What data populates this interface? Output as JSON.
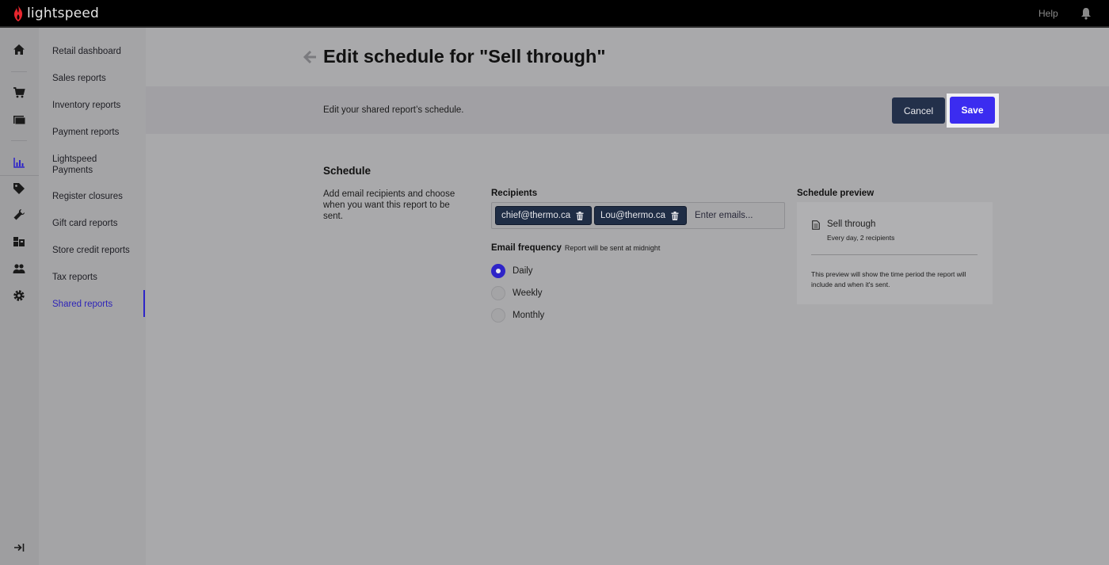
{
  "app": {
    "brand": "lightspeed",
    "help_label": "Help"
  },
  "colors": {
    "accent": "#3b2cf0",
    "dark_button": "#23304a",
    "active_nav": "#2e24b8"
  },
  "rail": {
    "icons": [
      "home-icon",
      "cart-icon",
      "register-icon",
      "reports-icon",
      "tag-icon",
      "wrench-icon",
      "inventory-icon",
      "customers-icon",
      "settings-icon"
    ],
    "collapse_icon": "collapse-icon"
  },
  "subnav": {
    "items": [
      {
        "label": "Retail dashboard"
      },
      {
        "label": "Sales reports"
      },
      {
        "label": "Inventory reports"
      },
      {
        "label": "Payment reports"
      },
      {
        "label": "Lightspeed Payments"
      },
      {
        "label": "Register closures"
      },
      {
        "label": "Gift card reports"
      },
      {
        "label": "Store credit reports"
      },
      {
        "label": "Tax reports"
      },
      {
        "label": "Shared reports",
        "active": true
      }
    ]
  },
  "header": {
    "title": "Edit schedule for \"Sell through\""
  },
  "band": {
    "text": "Edit your shared report’s schedule.",
    "cancel_label": "Cancel",
    "save_label": "Save"
  },
  "schedule": {
    "title": "Schedule",
    "description": "Add email recipients and choose when you want this report to be sent.",
    "recipients_label": "Recipients",
    "recipients": [
      "chief@thermo.ca",
      "Lou@thermo.ca"
    ],
    "email_placeholder": "Enter emails...",
    "frequency_label": "Email frequency",
    "frequency_note": "Report will be sent at midnight",
    "frequency_options": [
      {
        "label": "Daily",
        "checked": true
      },
      {
        "label": "Weekly",
        "checked": false
      },
      {
        "label": "Monthly",
        "checked": false
      }
    ]
  },
  "preview": {
    "label": "Schedule preview",
    "report_name": "Sell through",
    "summary": "Every day, 2 recipients",
    "note": "This preview will show the time period the report will include and when it's sent."
  }
}
